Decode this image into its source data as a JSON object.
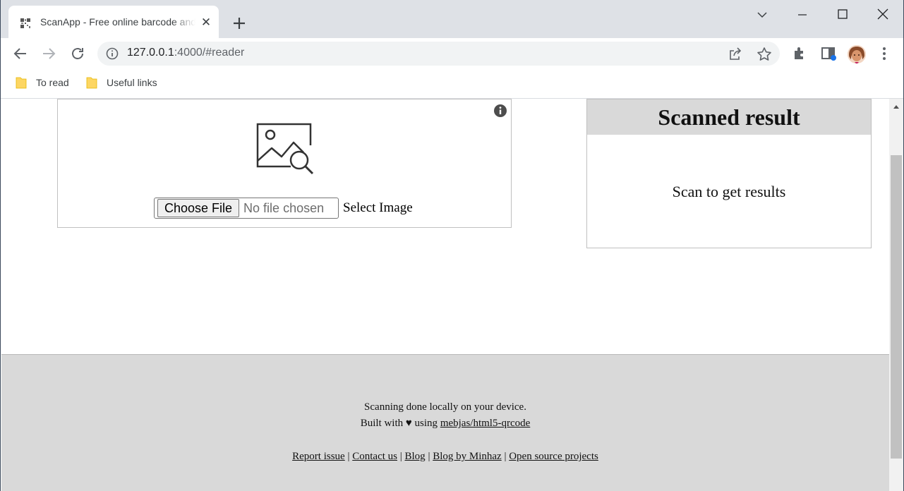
{
  "browser": {
    "tab_title": "ScanApp - Free online barcode and QR code scanner",
    "url_host": "127.0.0.1",
    "url_rest": ":4000/#reader",
    "bookmarks": [
      "To read",
      "Useful links"
    ],
    "icons": [
      "qr-favicon-icon",
      "close-icon",
      "plus-icon",
      "chevron-down-icon",
      "minimize-icon",
      "maximize-icon",
      "close-window-icon",
      "back-icon",
      "forward-icon",
      "reload-icon",
      "info-icon",
      "share-icon",
      "star-icon",
      "extensions-icon",
      "side-panel-icon",
      "avatar",
      "more-icon",
      "folder-icon"
    ]
  },
  "reader": {
    "choose_button": "Choose File",
    "file_status": "No file chosen",
    "select_label": "Select Image"
  },
  "result": {
    "heading": "Scanned result",
    "placeholder": "Scan to get results"
  },
  "footer": {
    "line1": "Scanning done locally on your device.",
    "built_prefix": "Built with ♥ using ",
    "built_link": "mebjas/html5-qrcode",
    "links": [
      "Report issue",
      "Contact us",
      "Blog",
      "Blog by Minhaz",
      "Open source projects"
    ]
  }
}
